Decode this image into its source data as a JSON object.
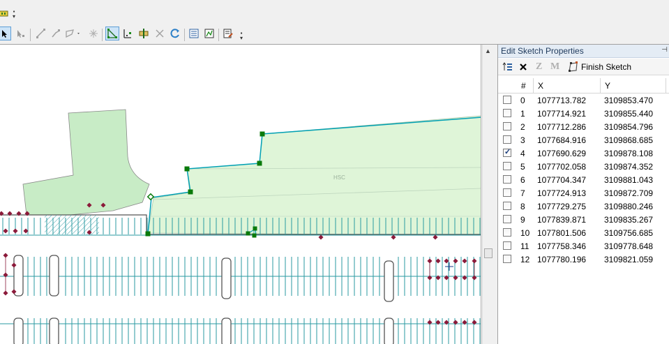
{
  "panel": {
    "title": "Edit Sketch Properties",
    "tools": {
      "z_label": "Z",
      "m_label": "M",
      "finish_label": "Finish Sketch"
    },
    "columns": [
      "#",
      "X",
      "Y"
    ],
    "rows": [
      {
        "idx": "0",
        "x": "1077713.782",
        "y": "3109853.470",
        "checked": false
      },
      {
        "idx": "1",
        "x": "1077714.921",
        "y": "3109855.440",
        "checked": false
      },
      {
        "idx": "2",
        "x": "1077712.286",
        "y": "3109854.796",
        "checked": false
      },
      {
        "idx": "3",
        "x": "1077684.916",
        "y": "3109868.685",
        "checked": false
      },
      {
        "idx": "4",
        "x": "1077690.629",
        "y": "3109878.108",
        "checked": true
      },
      {
        "idx": "5",
        "x": "1077702.058",
        "y": "3109874.352",
        "checked": false
      },
      {
        "idx": "6",
        "x": "1077704.347",
        "y": "3109881.043",
        "checked": false
      },
      {
        "idx": "7",
        "x": "1077724.913",
        "y": "3109872.709",
        "checked": false
      },
      {
        "idx": "8",
        "x": "1077729.275",
        "y": "3109880.246",
        "checked": false
      },
      {
        "idx": "9",
        "x": "1077839.871",
        "y": "3109835.267",
        "checked": false
      },
      {
        "idx": "10",
        "x": "1077801.506",
        "y": "3109756.685",
        "checked": false
      },
      {
        "idx": "11",
        "x": "1077758.346",
        "y": "3109778.648",
        "checked": false
      },
      {
        "idx": "12",
        "x": "1077780.196",
        "y": "3109821.059",
        "checked": false
      }
    ]
  },
  "map": {
    "polygon_label": "HSC",
    "sketch_color": "#00a0b4",
    "vertex_color": "#0a7a0a",
    "polygon_fill": "#dff5d8",
    "building_fill": "#c8ecc6",
    "parking_line_color": "#2a9aa0",
    "point_color": "#8b1a3a"
  },
  "toolbar": {
    "icons": [
      "select-arrow-icon",
      "edit-vertices-icon",
      "straight-segment-icon",
      "trace-icon",
      "reshape-icon",
      "cut-polygons-icon",
      "edit-sketch-icon",
      "topology-edit-icon",
      "split-icon",
      "delete-icon",
      "rotate-icon",
      "attributes-icon",
      "sketch-properties-icon",
      "create-features-icon"
    ]
  }
}
